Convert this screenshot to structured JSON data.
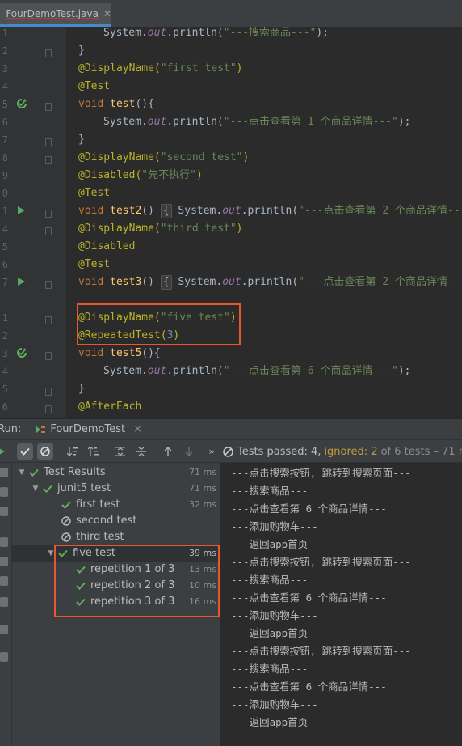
{
  "editor_tab": {
    "filename": "FourDemoTest.java",
    "close": "✕"
  },
  "gutter": {
    "line_numbers": [
      "1",
      "2",
      "3",
      "4",
      "5",
      "6",
      "7",
      "8",
      "9",
      "0",
      "1",
      "4",
      "5",
      "6",
      "7",
      "",
      "1",
      "2",
      "3",
      "4",
      "5",
      "6"
    ]
  },
  "code": {
    "l1": [
      "System.",
      "out",
      ".println(",
      "\"---搜索商品---\"",
      ");"
    ],
    "l2": "}",
    "l3": [
      "@DisplayName(",
      "\"first test\"",
      ")"
    ],
    "l4": "@Test",
    "l5": [
      "void ",
      "test",
      "(){"
    ],
    "l6": [
      "System.",
      "out",
      ".println(",
      "\"---点击查看第 1 个商品详情---\"",
      ");"
    ],
    "l7": "}",
    "l8": [
      "@DisplayName(",
      "\"second test\"",
      ")"
    ],
    "l9": [
      "@Disabled(",
      "\"先不执行\"",
      ")"
    ],
    "l10": "@Test",
    "l11": [
      "void ",
      "test2",
      "() ",
      "{",
      " System.",
      "out",
      ".println(",
      "\"---点击查看第 2 个商品详情---"
    ],
    "l12": [
      "@DisplayName(",
      "\"third test\"",
      ")"
    ],
    "l13": "@Disabled",
    "l14": "@Test",
    "l15": [
      "void ",
      "test3",
      "() ",
      "{",
      " System.",
      "out",
      ".println(",
      "\"---点击查看第 2 个商品详情---"
    ],
    "l16": "",
    "l17": [
      "@DisplayName(",
      "\"five test\"",
      ")"
    ],
    "l18": [
      "@RepeatedTest(",
      "3",
      ")"
    ],
    "l19": [
      "void ",
      "test5",
      "(){"
    ],
    "l20": [
      "System.",
      "out",
      ".println(",
      "\"---点击查看第 6 个商品详情---\"",
      ");"
    ],
    "l21": "}",
    "l22": "@AfterEach"
  },
  "run_panel": {
    "label": "Run:",
    "tab": "FourDemoTest",
    "close": "×",
    "more": "»"
  },
  "status": {
    "passed": "Tests passed: 4,",
    "ignored": "ignored: 2",
    "rest": "of 6 tests – 71 ms"
  },
  "tree": {
    "root": {
      "label": "Test Results",
      "duration": "71 ms"
    },
    "suite": {
      "label": "junit5 test",
      "duration": "71 ms"
    },
    "first": {
      "label": "first test",
      "duration": "32 ms"
    },
    "second": {
      "label": "second test",
      "duration": ""
    },
    "third": {
      "label": "third test",
      "duration": ""
    },
    "five": {
      "label": "five test",
      "duration": "39 ms"
    },
    "rep1": {
      "label": "repetition 1 of 3",
      "duration": "13 ms"
    },
    "rep2": {
      "label": "repetition 2 of 3",
      "duration": "10 ms"
    },
    "rep3": {
      "label": "repetition 3 of 3",
      "duration": "16 ms"
    }
  },
  "console": {
    "lines": [
      "---点击搜索按钮, 跳转到搜索页面---",
      "---搜索商品---",
      "---点击查看第 6 个商品详情---",
      "---添加购物车---",
      "---返回app首页---",
      "---点击搜索按钮, 跳转到搜索页面---",
      "---搜索商品---",
      "---点击查看第 6 个商品详情---",
      "---添加购物车---",
      "---返回app首页---",
      "---点击搜索按钮, 跳转到搜索页面---",
      "---搜索商品---",
      "---点击查看第 6 个商品详情---",
      "---添加购物车---",
      "---返回app首页---"
    ]
  },
  "colors": {
    "pass_green": "#5fb05a",
    "highlight_box": "#e8562f",
    "ignored_text": "#c49b3d",
    "tab_underline": "#4a88c7"
  }
}
